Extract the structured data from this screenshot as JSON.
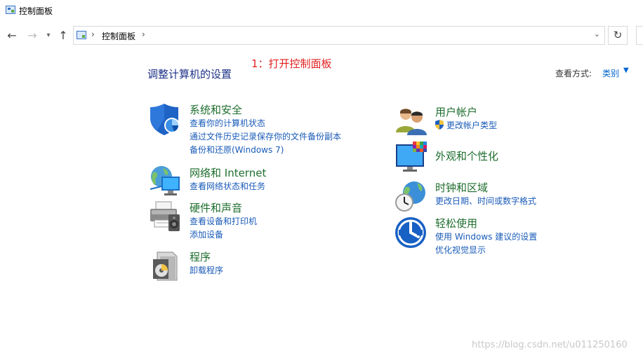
{
  "window": {
    "title": "控制面板"
  },
  "nav": {
    "back_icon": "back-arrow-icon",
    "forward_icon": "forward-arrow-icon",
    "recent_icon": "chevron-down-icon",
    "up_icon": "up-arrow-icon"
  },
  "address": {
    "separator": "›",
    "crumb": "控制面板",
    "dropdown": "⌄",
    "refresh": "↻"
  },
  "annotation": "1：打开控制面板",
  "header": {
    "title": "调整计算机的设置",
    "view_by_label": "查看方式:",
    "view_by_value": "类别"
  },
  "categories": {
    "security": {
      "title": "系统和安全",
      "links": [
        "查看你的计算机状态",
        "通过文件历史记录保存你的文件备份副本",
        "备份和还原(Windows 7)"
      ]
    },
    "network": {
      "title": "网络和 Internet",
      "links": [
        "查看网络状态和任务"
      ]
    },
    "hardware": {
      "title": "硬件和声音",
      "links": [
        "查看设备和打印机",
        "添加设备"
      ]
    },
    "programs": {
      "title": "程序",
      "links": [
        "卸载程序"
      ]
    },
    "accounts": {
      "title": "用户帐户",
      "links": [
        "更改帐户类型"
      ]
    },
    "appearance": {
      "title": "外观和个性化",
      "links": []
    },
    "clock": {
      "title": "时钟和区域",
      "links": [
        "更改日期、时间或数字格式"
      ]
    },
    "ease": {
      "title": "轻松使用",
      "links": [
        "使用 Windows 建议的设置",
        "优化视觉显示"
      ]
    }
  },
  "watermark": "https://blog.csdn.net/u011250160",
  "colors": {
    "category_title": "#1e6e2e",
    "link": "#1a5bb8",
    "heading": "#1e3287",
    "annotation": "#e02020"
  }
}
